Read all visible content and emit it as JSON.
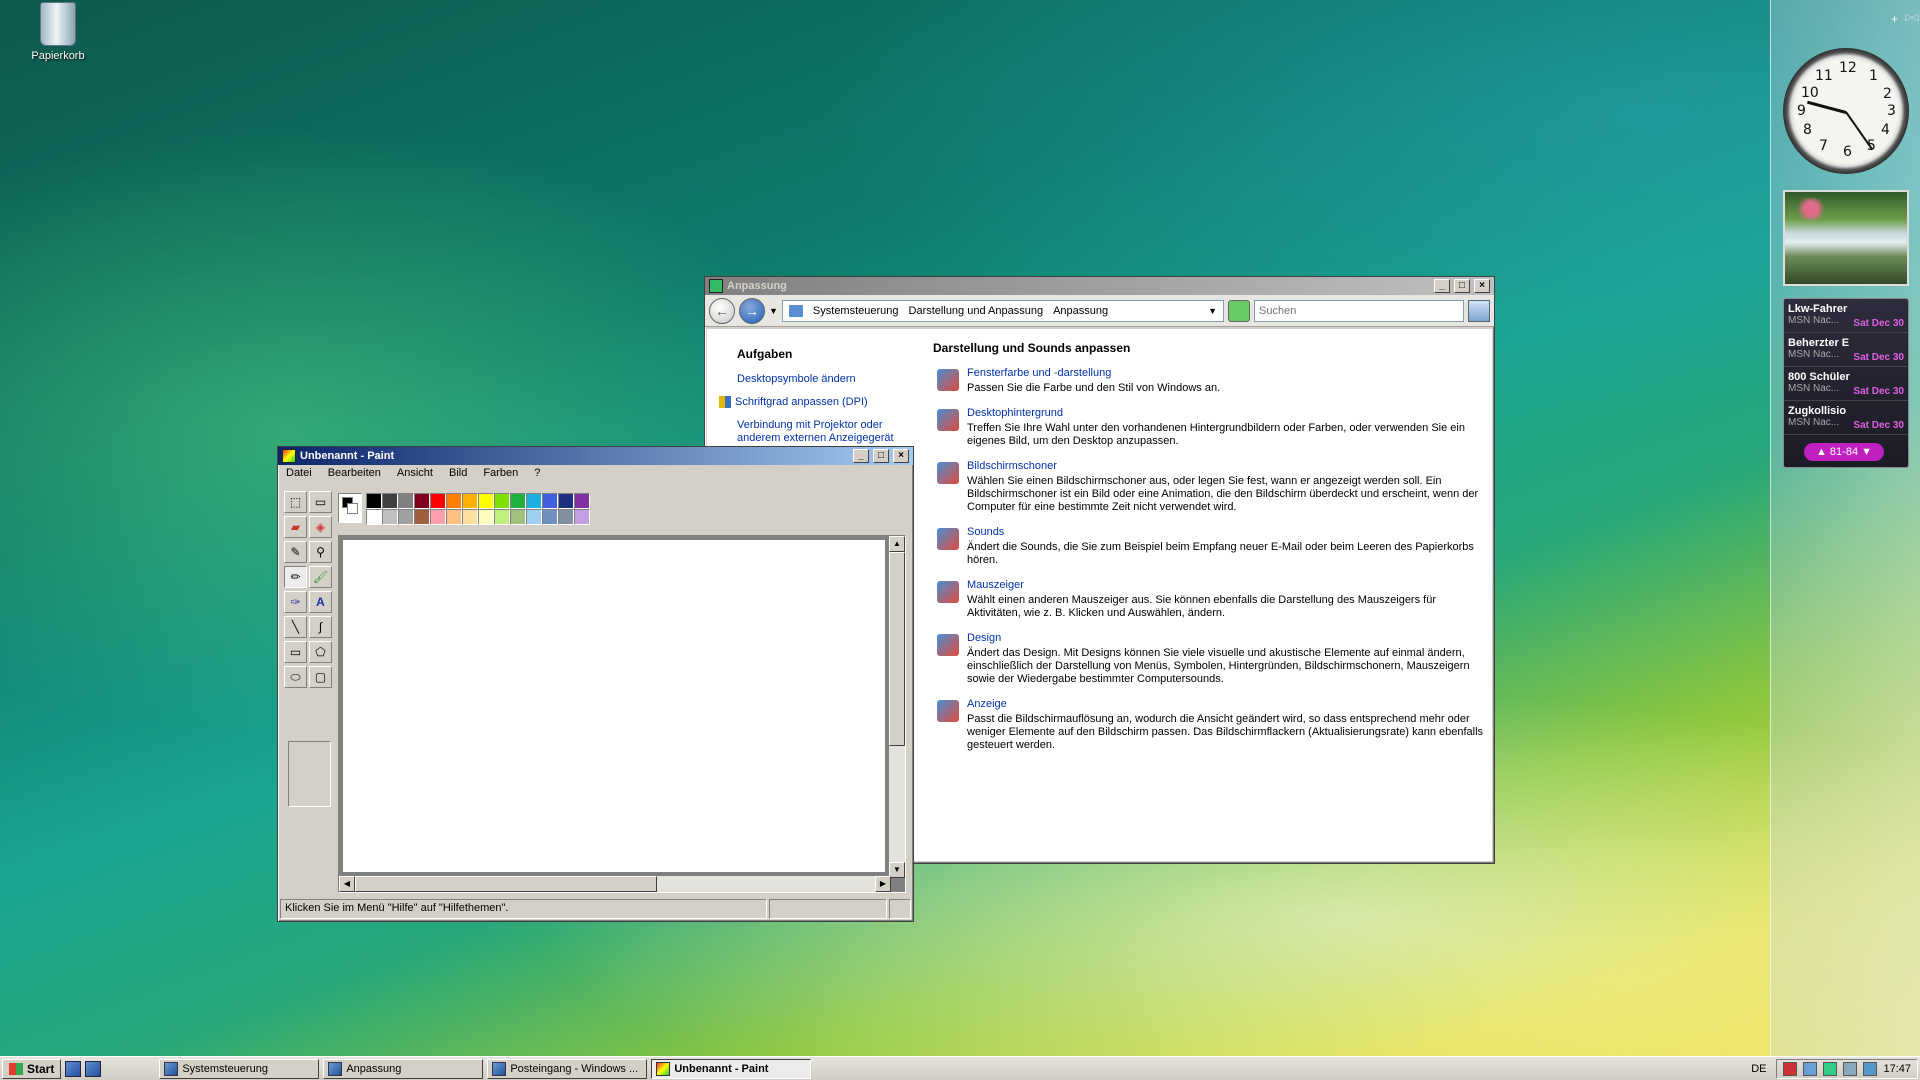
{
  "desktop": {
    "recycle_bin_label": "Papierkorb"
  },
  "sidebar": {
    "add_label": "+",
    "nav_prev": "◁",
    "nav_next": "▷",
    "clock_numbers": [
      "12",
      "1",
      "2",
      "3",
      "4",
      "5",
      "6",
      "7",
      "8",
      "9",
      "10",
      "11"
    ],
    "news_items": [
      {
        "title": "Lkw-Fahrer",
        "source": "MSN Nac...",
        "date": "Sat Dec 30"
      },
      {
        "title": "Beherzter E",
        "source": "MSN Nac...",
        "date": "Sat Dec 30"
      },
      {
        "title": "800 Schüler",
        "source": "MSN Nac...",
        "date": "Sat Dec 30"
      },
      {
        "title": "Zugkollisio",
        "source": "MSN Nac...",
        "date": "Sat Dec 30"
      }
    ],
    "news_range": "81-84"
  },
  "anpassung": {
    "title": "Anpassung",
    "breadcrumbs": [
      "Systemsteuerung",
      "Darstellung und Anpassung",
      "Anpassung"
    ],
    "search_placeholder": "Suchen",
    "tasks_heading": "Aufgaben",
    "tasks": [
      "Desktopsymbole ändern",
      "Schriftgrad anpassen (DPI)",
      "Verbindung mit Projektor oder anderem externen Anzeigegerät"
    ],
    "heading": "Darstellung und Sounds anpassen",
    "items": [
      {
        "link": "Fensterfarbe und -darstellung",
        "desc": "Passen Sie die Farbe und den Stil von Windows an."
      },
      {
        "link": "Desktophintergrund",
        "desc": "Treffen Sie Ihre Wahl unter den vorhandenen Hintergrundbildern oder Farben, oder verwenden Sie ein eigenes Bild, um den Desktop anzupassen."
      },
      {
        "link": "Bildschirmschoner",
        "desc": "Wählen Sie einen Bildschirmschoner aus, oder legen Sie fest, wann er angezeigt werden soll. Ein Bildschirmschoner ist ein Bild oder eine Animation, die den Bildschirm überdeckt und erscheint, wenn der Computer für eine bestimmte Zeit nicht verwendet wird."
      },
      {
        "link": "Sounds",
        "desc": "Ändert die Sounds, die Sie zum Beispiel beim Empfang neuer E-Mail oder beim Leeren des Papierkorbs hören."
      },
      {
        "link": "Mauszeiger",
        "desc": "Wählt einen anderen Mauszeiger aus. Sie können ebenfalls die Darstellung des Mauszeigers für Aktivitäten, wie z. B. Klicken und Auswählen, ändern."
      },
      {
        "link": "Design",
        "desc": "Ändert das Design. Mit Designs können Sie viele visuelle und akustische Elemente auf einmal ändern, einschließlich der Darstellung von Menüs, Symbolen, Hintergründen, Bildschirmschonern, Mauszeigern sowie der Wiedergabe bestimmter Computersounds."
      },
      {
        "link": "Anzeige",
        "desc": "Passt die Bildschirmauflösung an, wodurch die Ansicht geändert wird, so dass entsprechend mehr oder weniger Elemente auf den Bildschirm passen. Das Bildschirmflackern (Aktualisierungsrate) kann ebenfalls gesteuert werden."
      }
    ]
  },
  "paint": {
    "title": "Unbenannt - Paint",
    "menu": [
      "Datei",
      "Bearbeiten",
      "Ansicht",
      "Bild",
      "Farben",
      "?"
    ],
    "status": "Klicken Sie im Menü \"Hilfe\" auf \"Hilfethemen\".",
    "palette_top": [
      "#000000",
      "#404040",
      "#808080",
      "#800020",
      "#ff0000",
      "#ff8000",
      "#ffb000",
      "#ffff00",
      "#80e000",
      "#20b040",
      "#20b0e0",
      "#4060e0",
      "#203080",
      "#8030a0"
    ],
    "palette_bottom": [
      "#ffffff",
      "#c0c0c0",
      "#a0a0a0",
      "#a06040",
      "#ffa0b0",
      "#ffc080",
      "#ffe0a0",
      "#ffffc0",
      "#c0f080",
      "#a0c080",
      "#a0d0f0",
      "#7090c0",
      "#8090a0",
      "#c0a0e0"
    ]
  },
  "taskbar": {
    "start_label": "Start",
    "tasks": [
      {
        "label": "Systemsteuerung",
        "active": false
      },
      {
        "label": "Anpassung",
        "active": false
      },
      {
        "label": "Posteingang - Windows ...",
        "active": false
      },
      {
        "label": "Unbenannt - Paint",
        "active": true
      }
    ],
    "language": "DE",
    "time": "17:47"
  }
}
